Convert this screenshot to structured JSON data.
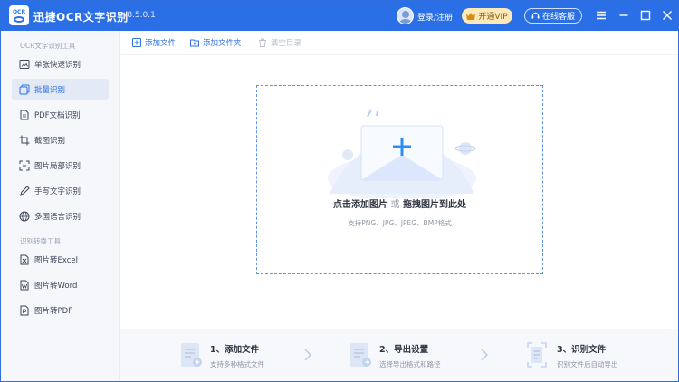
{
  "titlebar": {
    "app_title": "迅捷OCR文字识别",
    "version": "v8.5.0.1",
    "logo_text": "OCR",
    "login_label": "登录/注册",
    "vip_label": "开通VIP",
    "service_label": "在线客服"
  },
  "sidebar": {
    "section1_title": "OCR文字识别工具",
    "section2_title": "识别转换工具",
    "items": [
      {
        "label": "单张快速识别",
        "icon": "single-image-icon"
      },
      {
        "label": "批量识别",
        "icon": "batch-icon",
        "active": true
      },
      {
        "label": "PDF文档识别",
        "icon": "pdf-document-icon"
      },
      {
        "label": "截图识别",
        "icon": "crop-icon"
      },
      {
        "label": "图片局部识别",
        "icon": "partial-select-icon"
      },
      {
        "label": "手写文字识别",
        "icon": "handwriting-icon"
      },
      {
        "label": "多国语言识别",
        "icon": "globe-icon"
      },
      {
        "label": "图片转Excel",
        "icon": "excel-icon"
      },
      {
        "label": "图片转Word",
        "icon": "word-icon"
      },
      {
        "label": "图片转PDF",
        "icon": "pdf-icon"
      }
    ]
  },
  "toolbar": {
    "add_file": "添加文件",
    "add_folder": "添加文件夹",
    "clear_list": "清空目录"
  },
  "dropzone": {
    "title_part1": "点击添加图片",
    "title_or": "或",
    "title_part2": "拖拽图片到此处",
    "subtitle": "支持PNG、JPG、JPEG、BMP格式"
  },
  "steps": [
    {
      "title": "1、添加文件",
      "subtitle": "支持多种格式文件"
    },
    {
      "title": "2、导出设置",
      "subtitle": "选择导出格式和路径"
    },
    {
      "title": "3、识别文件",
      "subtitle": "识别文件后自动导出"
    }
  ],
  "colors": {
    "brand": "#2b6fe6",
    "vip_bg": "#fde9b8",
    "sidebar_bg": "#f5f7fb",
    "active_bg": "#e3e9f5"
  }
}
